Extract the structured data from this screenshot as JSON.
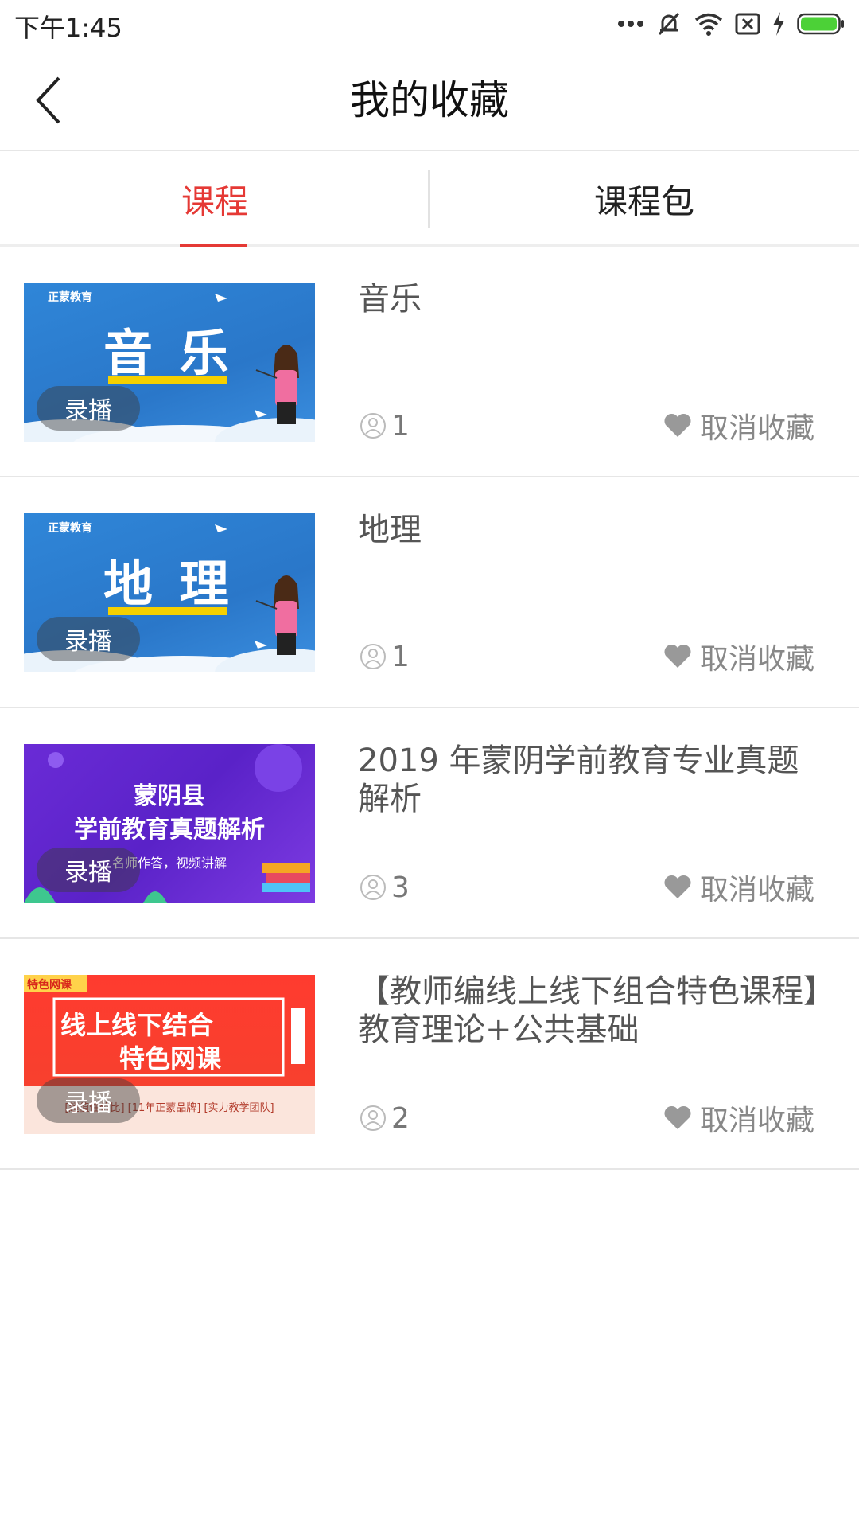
{
  "status_bar": {
    "time": "下午1:45"
  },
  "header": {
    "title": "我的收藏"
  },
  "tabs": [
    {
      "label": "课程",
      "active": true
    },
    {
      "label": "课程包",
      "active": false
    }
  ],
  "colors": {
    "accent": "#e53935",
    "divider": "#e6e6e6"
  },
  "courses": [
    {
      "title": "音乐",
      "badge": "录播",
      "students": "1",
      "unfavorite_label": "取消收藏",
      "thumb": {
        "logo": "正蒙教育",
        "big_text": "音 乐"
      }
    },
    {
      "title": "地理",
      "badge": "录播",
      "students": "1",
      "unfavorite_label": "取消收藏",
      "thumb": {
        "logo": "正蒙教育",
        "big_text": "地 理"
      }
    },
    {
      "title": "2019 年蒙阴学前教育专业真题解析",
      "badge": "录播",
      "students": "3",
      "unfavorite_label": "取消收藏",
      "thumb": {
        "line1": "蒙阴县",
        "line2": "学前教育真题解析",
        "line3": "名师作答，视频讲解"
      }
    },
    {
      "title": "【教师编线上线下组合特色课程】教育理论+公共基础",
      "badge": "录播",
      "students": "2",
      "unfavorite_label": "取消收藏",
      "thumb": {
        "tag": "特色网课",
        "line1": "线上线下结合",
        "line2": "特色网课",
        "line3": "[超值性价比] [11年正蒙品牌] [实力教学团队]"
      }
    }
  ]
}
